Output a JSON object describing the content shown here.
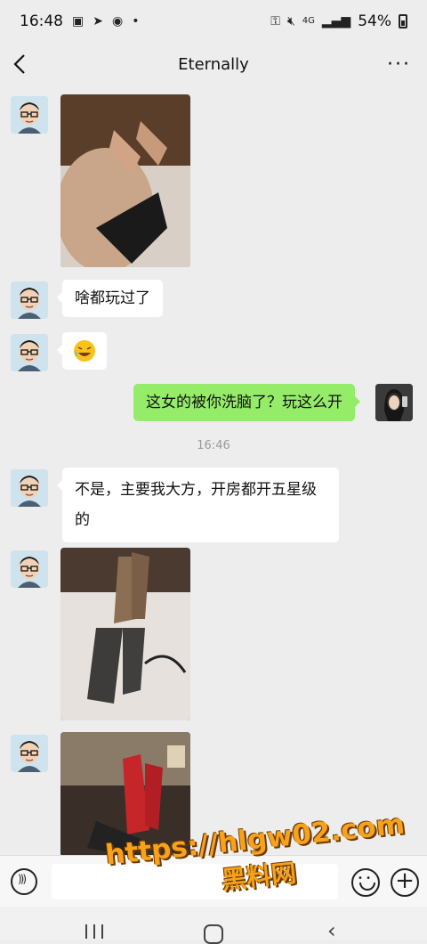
{
  "status_bar": {
    "time": "16:48",
    "battery": "54%",
    "network": "4G"
  },
  "header": {
    "title": "Eternally",
    "back_icon": "chevron-left-icon",
    "more_icon": "more-dots-icon"
  },
  "messages": [
    {
      "sender": "them",
      "type": "image",
      "description_icon": "photo"
    },
    {
      "sender": "them",
      "type": "text",
      "text": "啥都玩过了"
    },
    {
      "sender": "them",
      "type": "emoji",
      "text": "😅"
    },
    {
      "sender": "me",
      "type": "text",
      "text": "这女的被你洗脑了？玩这么开"
    },
    {
      "sender": "them",
      "type": "text",
      "text": "不是，主要我大方，开房都开五星级的"
    },
    {
      "sender": "them",
      "type": "image"
    },
    {
      "sender": "them",
      "type": "image"
    }
  ],
  "timestamp": "16:46",
  "input_bar": {
    "voice_icon": "voice-icon",
    "emoji_icon": "emoji-icon",
    "plus_icon": "plus-icon",
    "placeholder": ""
  },
  "watermark": {
    "url": "https://hlgw02.com",
    "label": "黑料网"
  },
  "colors": {
    "background": "#ededed",
    "my_bubble": "#95ec69",
    "their_bubble": "#ffffff",
    "watermark": "#f7a21a"
  }
}
